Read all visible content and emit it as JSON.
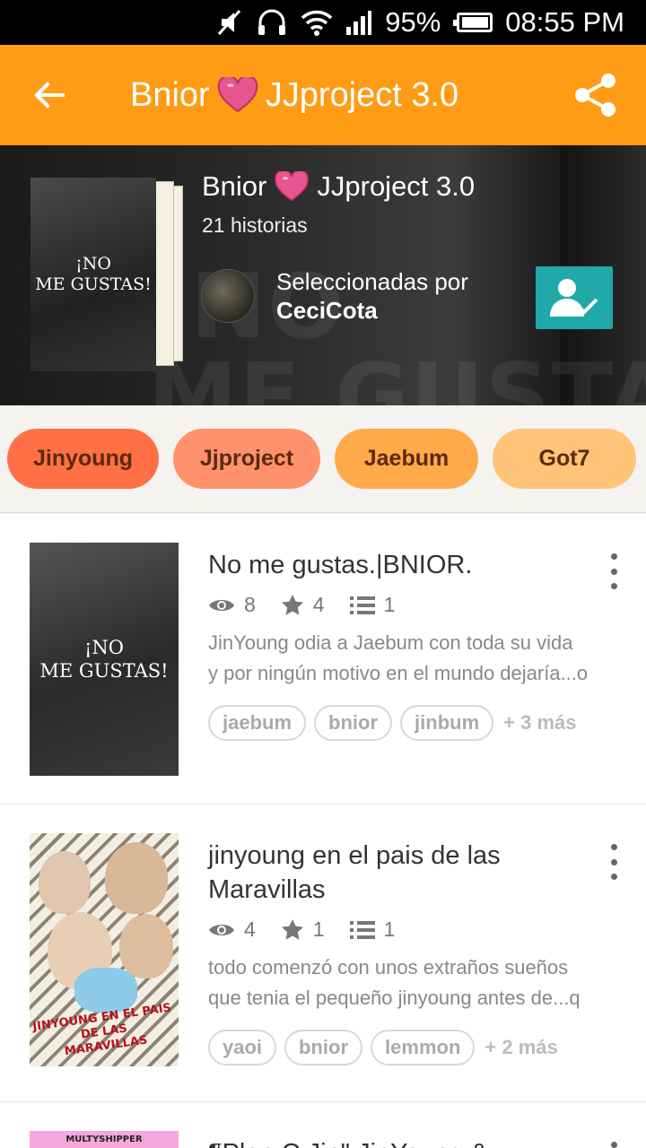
{
  "status_bar": {
    "battery": "95%",
    "time": "08:55 PM",
    "battery_level": 0.95
  },
  "toolbar": {
    "title_a": "Bnior",
    "title_b": "JJproject 3.0"
  },
  "list_header": {
    "title_a": "Bnior",
    "title_b": "JJproject 3.0",
    "story_count": "21 historias",
    "cover_text": "¡NO\nME GUSTAS!",
    "bg_text": "¡NO\nME GUSTAS!",
    "curated_label": "Seleccionadas por",
    "curator_name": "CeciCota"
  },
  "tags": [
    {
      "label": "Jinyoung",
      "color": "#ff7045"
    },
    {
      "label": "Jjproject",
      "color": "#ff916d"
    },
    {
      "label": "Jaebum",
      "color": "#ffa94a"
    },
    {
      "label": "Got7",
      "color": "#ffc478"
    }
  ],
  "stories": [
    {
      "title": "No me gustas.|BNIOR.",
      "reads": "8",
      "votes": "4",
      "parts": "1",
      "description_1": "JinYoung odia a Jaebum con toda su vida",
      "description_2": "y por ningún motivo en el mundo dejaría...o",
      "cover_text": "¡NO\nME GUSTAS!",
      "tags": [
        "jaebum",
        "bnior",
        "jinbum"
      ],
      "more": "+ 3 más"
    },
    {
      "title": "jinyoung en el pais de las Maravillas",
      "reads": "4",
      "votes": "1",
      "parts": "1",
      "description_1": "todo comenzó con unos extraños sueños",
      "description_2": "que tenia el pequeño jinyoung antes de...q",
      "cover_text": "JINYOUNG EN EL PAIS DE LAS MARAVILLAS",
      "tags": [
        "yaoi",
        "bnior",
        "lemmon"
      ],
      "more": "+ 2 más"
    },
    {
      "title": "¶Plan C Jin\" JinYoung &",
      "cover_text": "MULTYSHIPPER"
    }
  ],
  "colors": {
    "accent": "#ff9b14",
    "follow": "#20a9a8",
    "heart": "#e8558f"
  }
}
